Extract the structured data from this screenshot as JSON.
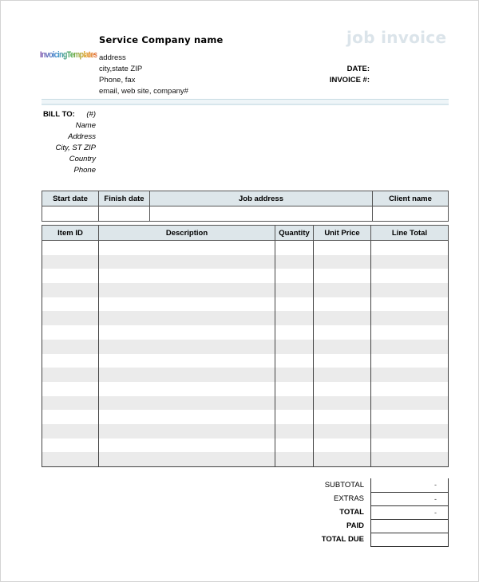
{
  "header": {
    "logo_text": "InvoicingTemplates",
    "company_name": "Service Company name",
    "address_lines": [
      "address",
      "city,state ZIP",
      "Phone, fax",
      "email, web site, company#"
    ],
    "title": "job invoice",
    "date_label": "DATE:",
    "invoice_label": "INVOICE #:",
    "title_color": "#dbe4ea"
  },
  "bill_to": {
    "label": "BILL TO:",
    "number": "(#)",
    "fields": [
      "Name",
      "Address",
      "City, ST ZIP",
      "Country",
      "Phone"
    ]
  },
  "job_table": {
    "columns": [
      "Start date",
      "Finish date",
      "Job address",
      "Client name"
    ],
    "rows": [
      [
        "",
        "",
        "",
        ""
      ]
    ]
  },
  "items_table": {
    "columns": [
      "Item ID",
      "Description",
      "Quantity",
      "Unit Price",
      "Line Total"
    ],
    "row_count": 16,
    "header_bg": "#dde6ea",
    "stripe_color": "#ebebeb"
  },
  "totals": [
    {
      "label": "SUBTOTAL",
      "value": "-",
      "bold": false
    },
    {
      "label": "EXTRAS",
      "value": "-",
      "bold": false
    },
    {
      "label": "TOTAL",
      "value": "-",
      "bold": true
    },
    {
      "label": "PAID",
      "value": "",
      "bold": true
    },
    {
      "label": "TOTAL DUE",
      "value": "",
      "bold": true
    }
  ]
}
